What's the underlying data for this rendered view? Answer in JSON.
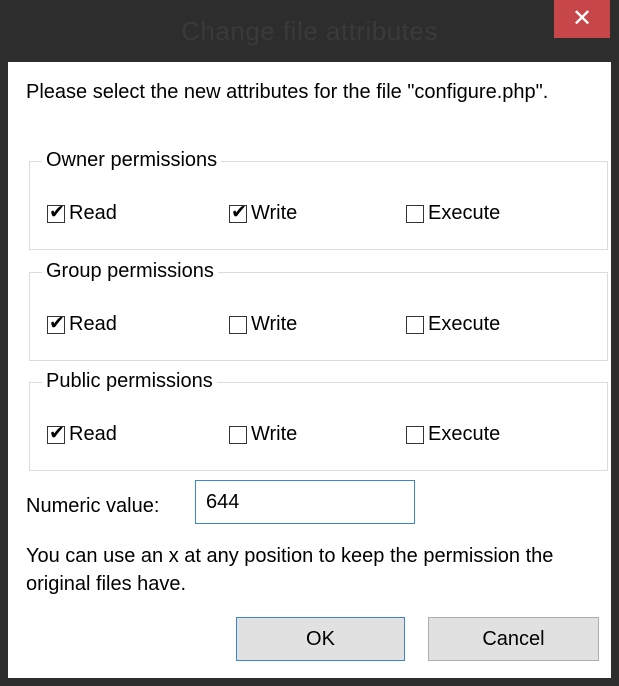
{
  "dialog": {
    "title": "Change file attributes",
    "close_glyph": "✕",
    "intro": "Please select the new attributes for the file \"configure.php\".",
    "labels": {
      "read": "Read",
      "write": "Write",
      "execute": "Execute"
    },
    "groups": [
      {
        "legend": "Owner permissions",
        "read": true,
        "write": true,
        "execute": false
      },
      {
        "legend": "Group permissions",
        "read": true,
        "write": false,
        "execute": false
      },
      {
        "legend": "Public permissions",
        "read": true,
        "write": false,
        "execute": false
      }
    ],
    "numeric_label": "Numeric value:",
    "numeric_value": "644",
    "hint": "You can use an x at any position to keep the permission the original files have.",
    "ok_label": "OK",
    "cancel_label": "Cancel"
  }
}
